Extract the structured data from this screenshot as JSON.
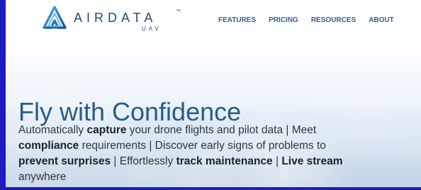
{
  "brand": {
    "name": "AIRDATA",
    "tm": "™",
    "sub": "UAV"
  },
  "nav": {
    "items": [
      {
        "label": "FEATURES"
      },
      {
        "label": "PRICING"
      },
      {
        "label": "RESOURCES"
      },
      {
        "label": "ABOUT"
      }
    ]
  },
  "hero": {
    "title": "Fly with Confidence",
    "lines": [
      {
        "part1": "Automatically ",
        "bold1": "capture",
        "part2": " your drone flights and pilot data | Meet"
      },
      {
        "bold1": "compliance",
        "part1": " requirements | Discover early signs of problems to"
      },
      {
        "bold1": "prevent surprises",
        "part1": " | Effortlessly ",
        "bold2": "track maintenance",
        "part2": " | ",
        "bold3": "Live stream"
      },
      {
        "part1": "anywhere"
      }
    ]
  },
  "colors": {
    "accent": "#2a5c86",
    "nav": "#355d8d",
    "brand": "#254b78",
    "frame": "#1e1bbf"
  },
  "icons": {
    "logo": "airdata-logo-icon"
  }
}
